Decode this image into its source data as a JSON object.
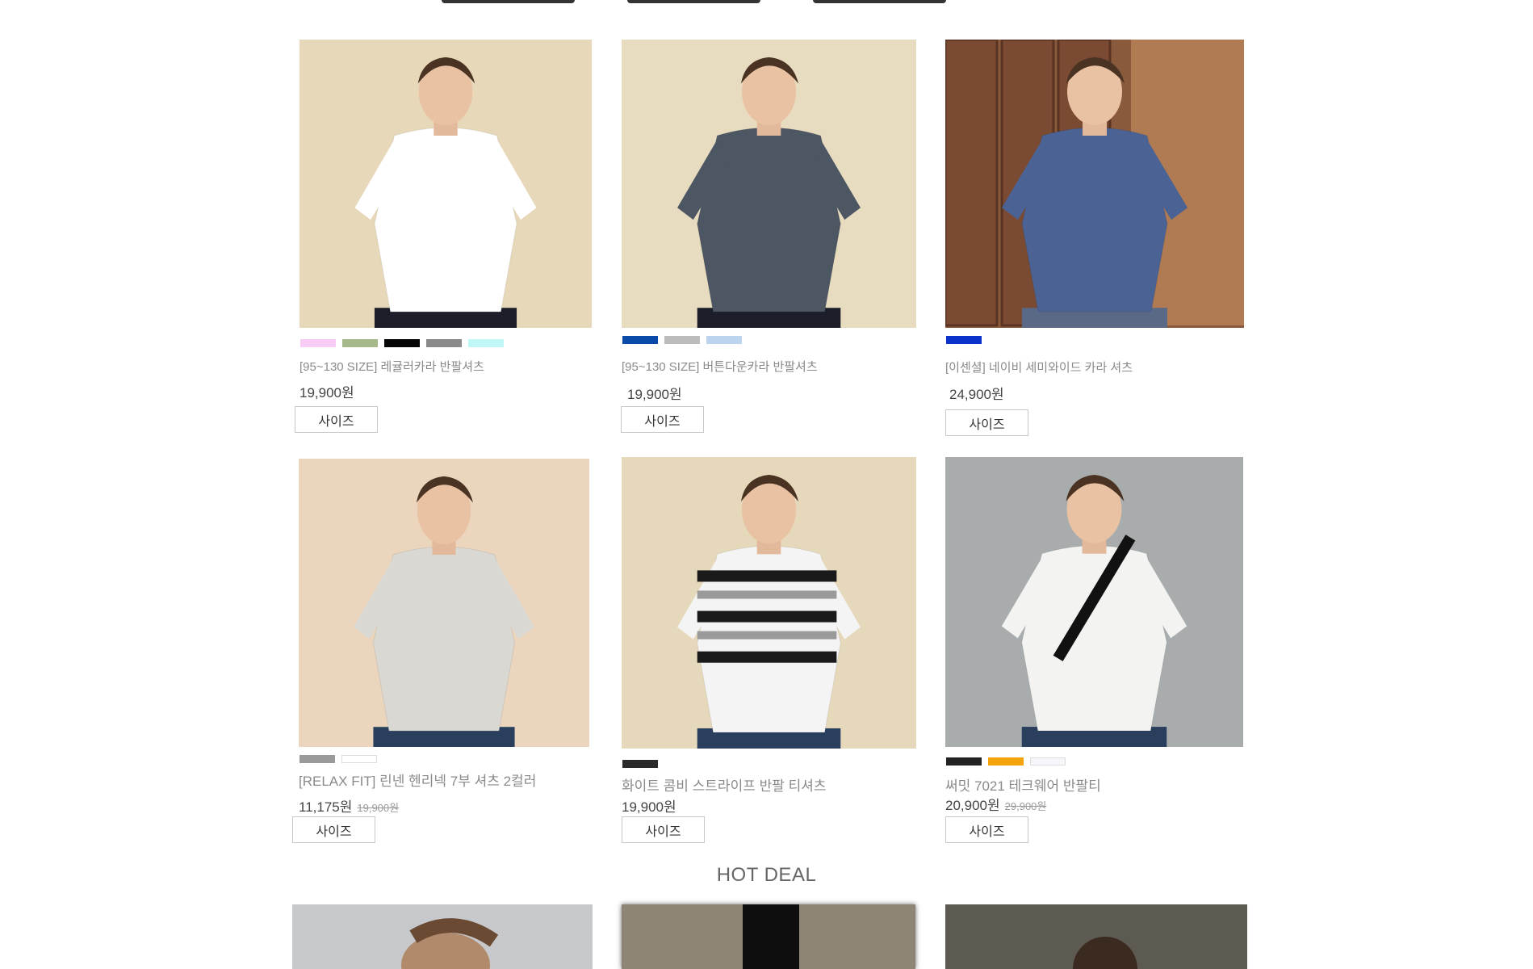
{
  "top_tabs": [
    "",
    "",
    ""
  ],
  "products": [
    {
      "name": "[95~130 SIZE] 레귤러카라 반팔셔츠",
      "price": "19,900원",
      "original_price": "",
      "size_label": "사이즈",
      "swatches": [
        "#f9ccf5",
        "#a7b98a",
        "#050505",
        "#8a8a8a",
        "#bff7f7"
      ],
      "shirt": "#ffffff",
      "bg": "#e7d8b9"
    },
    {
      "name": "[95~130 SIZE] 버튼다운카라 반팔셔츠",
      "price": "19,900원",
      "original_price": "",
      "size_label": "사이즈",
      "swatches": [
        "#0a4aa8",
        "#bcbcbc",
        "#bcd4ee"
      ],
      "shirt": "#4d5663",
      "bg": "#e8dcc0"
    },
    {
      "name": "[이센셜] 네이비 세미와이드 카라 셔츠",
      "price": "24,900원",
      "original_price": "",
      "size_label": "사이즈",
      "swatches": [
        "#0b33c9"
      ],
      "shirt": "#4a6394",
      "bg": "#8a5a3c"
    },
    {
      "name": "[RELAX FIT] 린넨 헨리넥 7부 셔츠 2컬러",
      "price": "11,175원",
      "original_price": "19,900원",
      "size_label": "사이즈",
      "swatches": [
        "#9a9a9a",
        "#ffffff"
      ],
      "shirt": "#d9d8d3",
      "bg": "#ecd5bd"
    },
    {
      "name": "화이트 콤비 스트라이프 반팔 티셔츠",
      "price": "19,900원",
      "original_price": "",
      "size_label": "사이즈",
      "swatches": [
        "#2a2a2a"
      ],
      "shirt": "#f4f4f4",
      "bg": "#e6d8bb"
    },
    {
      "name": "써밋 7021 테크웨어 반팔티",
      "price": "20,900원",
      "original_price": "29,900원",
      "size_label": "사이즈",
      "swatches": [
        "#222222",
        "#f5a30a",
        "#f5f5fa"
      ],
      "shirt": "#f3f3f1",
      "bg": "#a8acad"
    }
  ],
  "hot_deal_title": "HOT DEAL",
  "colors": {
    "accent": "#444444"
  }
}
